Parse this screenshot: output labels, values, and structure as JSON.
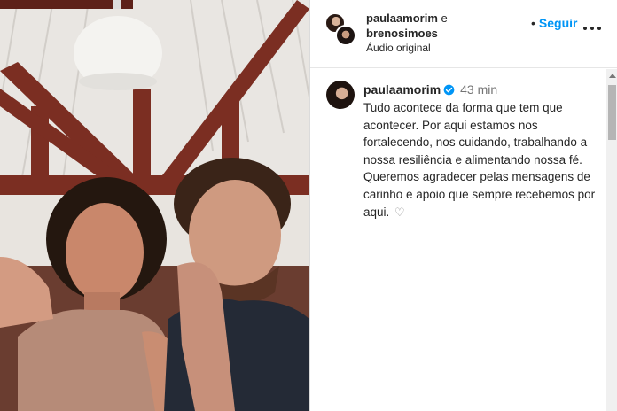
{
  "header": {
    "user1": "paulaamorim",
    "conjunction": "e",
    "user2": "brenosimoes",
    "subtitle": "Áudio original",
    "follow_separator": "•",
    "follow_label": "Seguir"
  },
  "comment": {
    "username": "paulaamorim",
    "time": "43 min",
    "text": "Tudo acontece da forma que tem que acontecer. Por aqui estamos nos fortalecendo, nos cuidando, trabalhando a nossa resiliência e alimentando nossa fé. Queremos agradecer pelas mensagens de carinho e apoio que sempre recebemos por aqui.",
    "heart": "♡"
  },
  "colors": {
    "follow": "#0095f6",
    "verified": "#0095f6",
    "text": "#262626",
    "muted": "#737373"
  },
  "icons": [
    "verified-badge-icon",
    "more-options-icon",
    "heart-icon"
  ]
}
